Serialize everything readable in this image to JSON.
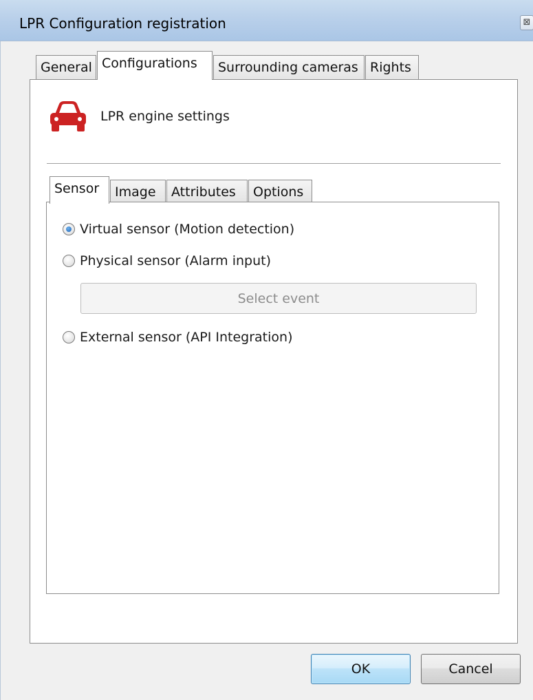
{
  "window": {
    "title": "LPR Configuration registration",
    "close_label": "⊠"
  },
  "tabs": [
    {
      "label": "General",
      "active": false
    },
    {
      "label": "Configurations",
      "active": true
    },
    {
      "label": "Surrounding cameras",
      "active": false
    },
    {
      "label": "Rights",
      "active": false
    }
  ],
  "section": {
    "icon": "car-icon",
    "icon_color": "#cc2222",
    "label": "LPR engine settings"
  },
  "inner_tabs": [
    {
      "label": "Sensor",
      "active": true
    },
    {
      "label": "Image",
      "active": false
    },
    {
      "label": "Attributes",
      "active": false
    },
    {
      "label": "Options",
      "active": false
    }
  ],
  "sensor": {
    "options": [
      {
        "label": "Virtual sensor (Motion detection)",
        "checked": true
      },
      {
        "label": "Physical sensor (Alarm input)",
        "checked": false
      },
      {
        "label": "External sensor (API Integration)",
        "checked": false
      }
    ],
    "select_event_label": "Select event"
  },
  "buttons": {
    "ok": "OK",
    "cancel": "Cancel"
  }
}
